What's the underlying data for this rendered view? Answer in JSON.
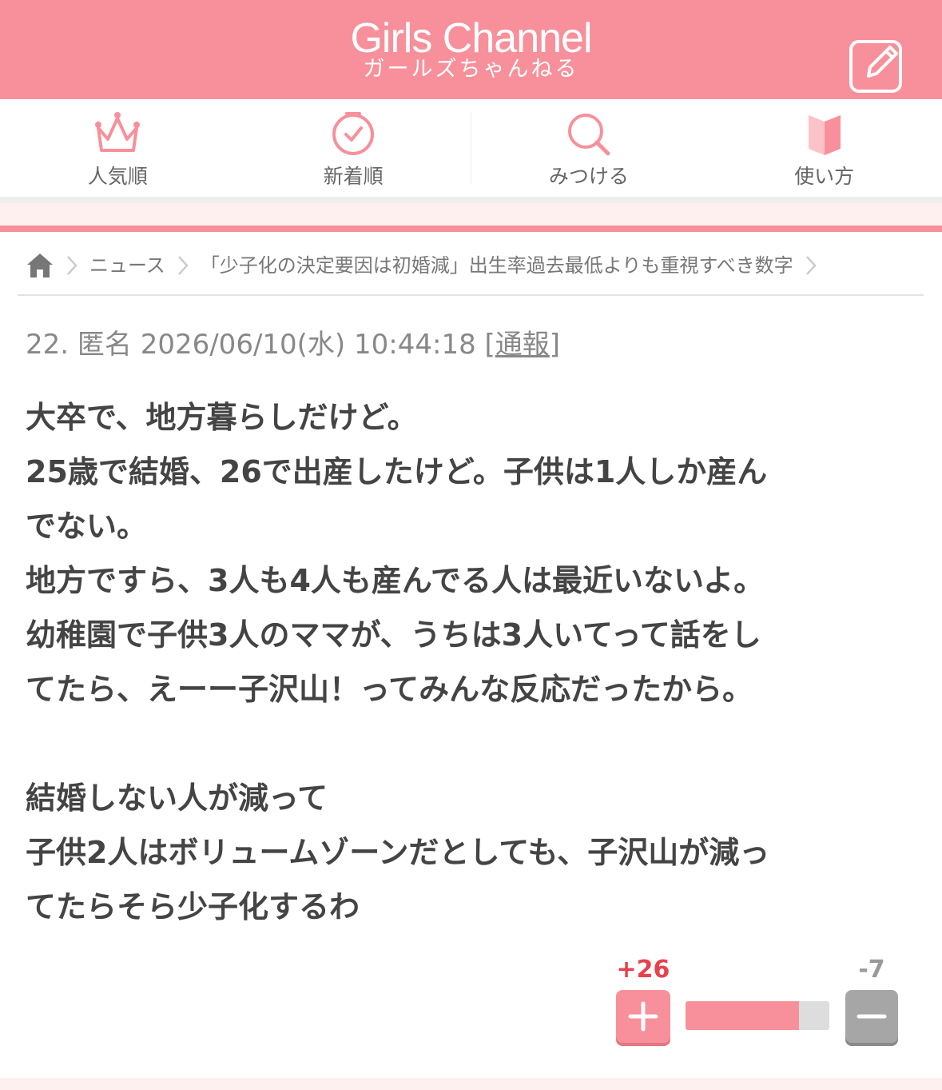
{
  "header": {
    "logo_title": "Girls Channel",
    "logo_subtitle": "ガールズちゃんねる",
    "post_icon": "edit-icon",
    "color": "#f7909a"
  },
  "nav": {
    "items": [
      {
        "label": "人気順",
        "icon": "crown-icon"
      },
      {
        "label": "新着順",
        "icon": "clock-icon"
      },
      {
        "label": "みつける",
        "icon": "search-icon"
      },
      {
        "label": "使い方",
        "icon": "book-icon"
      }
    ]
  },
  "breadcrumb": {
    "home_icon": "home-icon",
    "items": [
      "ニュース",
      "「少子化の決定要因は初婚減」出生率過去最低よりも重視すべき数字"
    ]
  },
  "post": {
    "number": "22.",
    "author": "匿名",
    "datetime": "2026/06/10(水) 10:44:18",
    "report_open": "[",
    "report_label": "通報",
    "report_close": "]",
    "body_lines": [
      "大卒で、地方暮らしだけど。",
      "25歳で結婚、26で出産したけど。子供は1人しか産ん",
      "でない。",
      "地方ですら、3人も4人も産んでる人は最近いないよ。",
      "幼稚園で子供3人のママが、うちは3人いてって話をし",
      "てたら、えーー子沢山！ってみんな反応だったから。",
      "",
      "結婚しない人が減って",
      "子供2人はボリュームゾーンだとしても、子沢山が減っ",
      "てたらそら少子化するわ"
    ]
  },
  "votes": {
    "plus": "+26",
    "minus": "-7",
    "plus_fraction": 0.7879,
    "plus_color": "#e8414c"
  }
}
